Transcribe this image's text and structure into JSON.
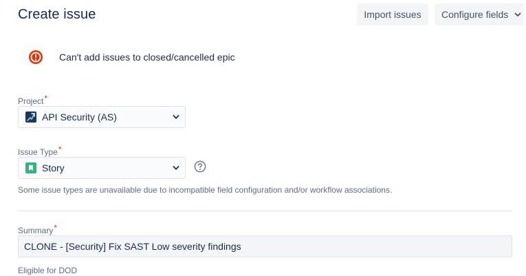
{
  "header": {
    "title": "Create issue",
    "import_label": "Import issues",
    "configure_label": "Configure fields"
  },
  "error": {
    "message": "Can't add issues to closed/cancelled epic",
    "icon": "error-icon",
    "color": "#de350b"
  },
  "fields": {
    "project": {
      "label": "Project",
      "required_mark": "*",
      "value": "API Security (AS)",
      "icon": "project-avatar-icon"
    },
    "issue_type": {
      "label": "Issue Type",
      "required_mark": "*",
      "value": "Story",
      "icon": "story-icon",
      "hint": "Some issue types are unavailable due to incompatible field configuration and/or workflow associations."
    },
    "summary": {
      "label": "Summary",
      "required_mark": "*",
      "value": "CLONE - [Security] Fix SAST Low severity findings"
    },
    "eligible_for_dod": {
      "label": "Eligible for DOD"
    }
  },
  "colors": {
    "required": "#de350b",
    "story_green": "#36b37e",
    "text": "#172b4d",
    "muted": "#5e6c84"
  }
}
